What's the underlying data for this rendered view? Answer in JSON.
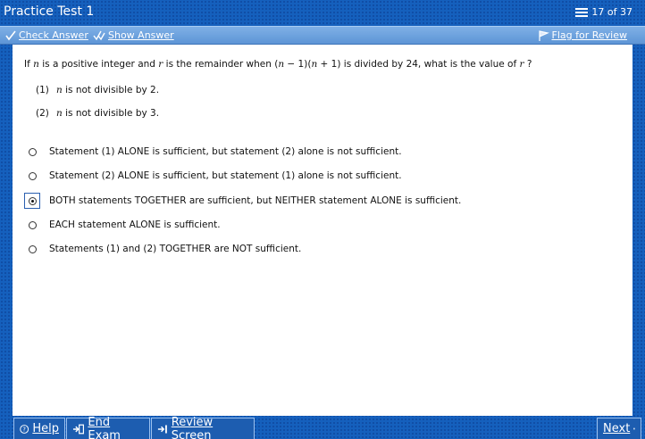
{
  "header": {
    "title": "Practice Test 1",
    "counter": "17 of 37",
    "counter_icon": "list-icon"
  },
  "toolbar": {
    "check_answer": "Check Answer",
    "show_answer": "Show Answer",
    "flag_for_review": "Flag for Review"
  },
  "question": {
    "text_if": "If ",
    "var_n": "n",
    "text_1": " is a positive integer and ",
    "var_r": "r",
    "text_2": " is the remainder when (",
    "text_3": " − 1)(",
    "text_4": " + 1) is divided by 24, what is the value of ",
    "text_5": " ?"
  },
  "statements": [
    {
      "num": "(1)",
      "var": "n",
      "text": " is not divisible by 2."
    },
    {
      "num": "(2)",
      "var": "n",
      "text": " is not divisible by 3."
    }
  ],
  "options": [
    {
      "text": "Statement (1) ALONE is sufficient, but statement (2) alone is not sufficient.",
      "selected": false
    },
    {
      "text": "Statement (2) ALONE is sufficient, but statement (1) alone is not sufficient.",
      "selected": false
    },
    {
      "text": "BOTH statements TOGETHER are sufficient, but NEITHER statement ALONE is sufficient.",
      "selected": true
    },
    {
      "text": "EACH statement ALONE is sufficient.",
      "selected": false
    },
    {
      "text": "Statements (1) and (2) TOGETHER are NOT sufficient.",
      "selected": false
    }
  ],
  "footer": {
    "help": "Help",
    "end_exam": "End Exam",
    "review_screen": "Review Screen",
    "next": "Next"
  },
  "colors": {
    "background": "#1560bd",
    "toolbar": "#6fa3e0",
    "content": "#ffffff"
  }
}
